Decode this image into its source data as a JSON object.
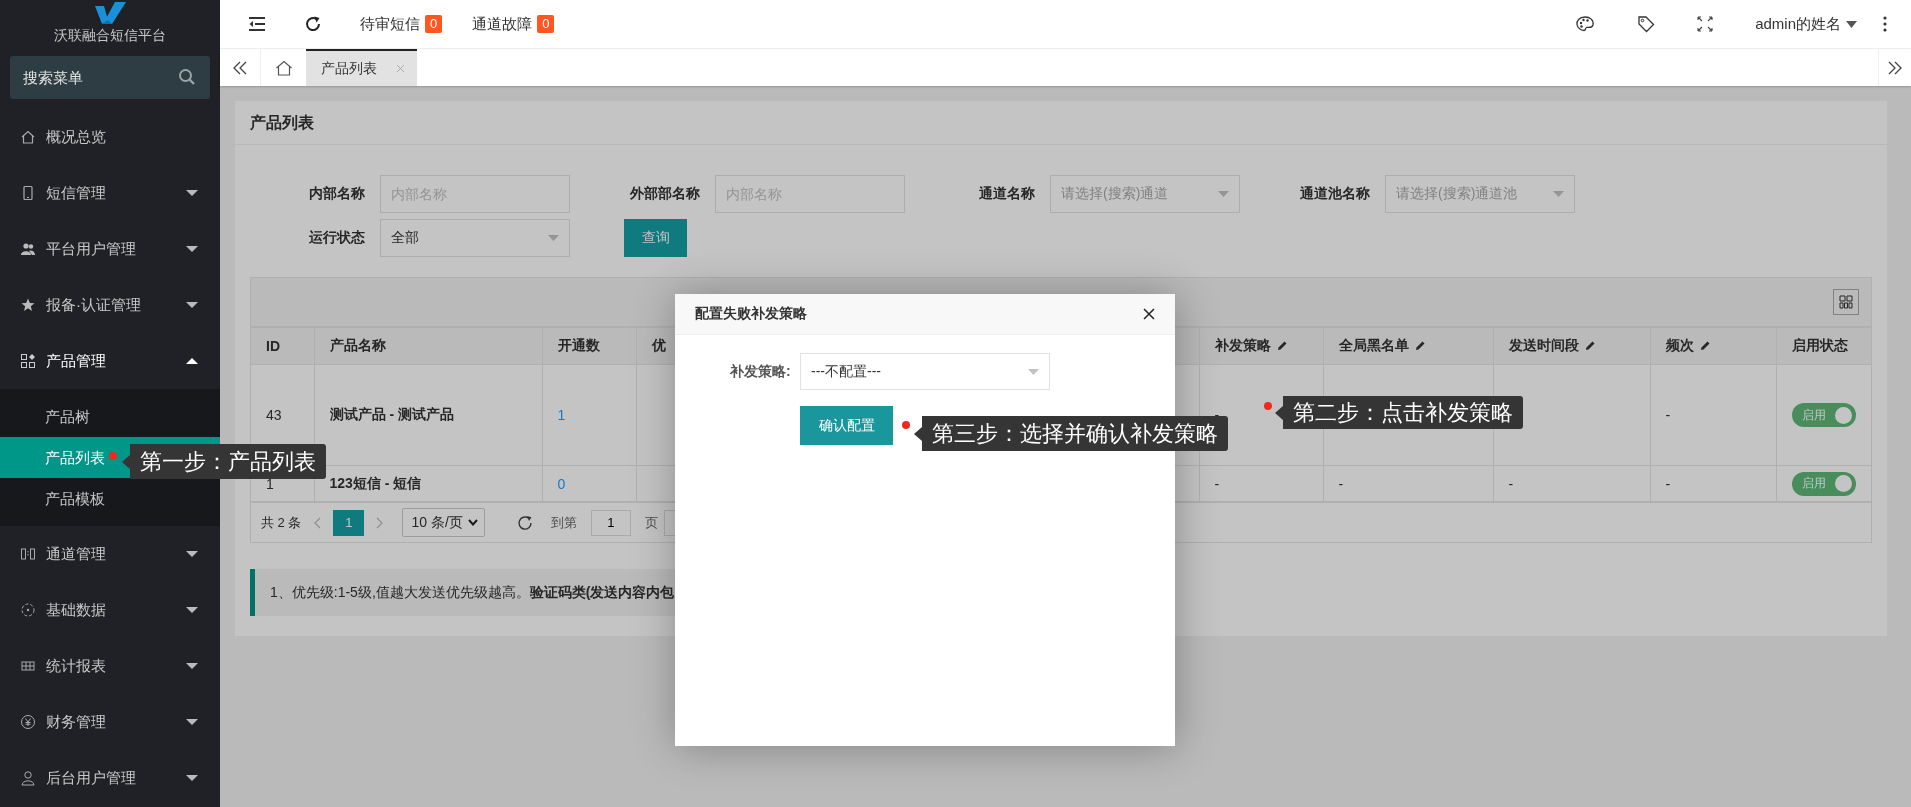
{
  "sidebar": {
    "logo_text": "沃联融合短信平台",
    "search": {
      "placeholder": "搜索菜单"
    },
    "items": [
      {
        "label": "概况总览",
        "selected": false
      },
      {
        "label": "短信管理",
        "selected": false,
        "expanded": false
      },
      {
        "label": "平台用户管理",
        "selected": false,
        "expanded": false
      },
      {
        "label": "报备·认证管理",
        "selected": false,
        "expanded": false
      },
      {
        "label": "产品管理",
        "selected": false,
        "expanded": true,
        "children": [
          {
            "label": "产品树",
            "selected": false
          },
          {
            "label": "产品列表",
            "selected": true
          },
          {
            "label": "产品模板",
            "selected": false
          }
        ]
      },
      {
        "label": "通道管理",
        "selected": false,
        "expanded": false
      },
      {
        "label": "基础数据",
        "selected": false,
        "expanded": false
      },
      {
        "label": "统计报表",
        "selected": false,
        "expanded": false
      },
      {
        "label": "财务管理",
        "selected": false,
        "expanded": false
      },
      {
        "label": "后台用户管理",
        "selected": false,
        "expanded": false
      }
    ]
  },
  "header": {
    "alerts": [
      {
        "label": "待审短信",
        "count": "0"
      },
      {
        "label": "通道故障",
        "count": "0"
      }
    ],
    "user": "admin的姓名"
  },
  "tabs": [
    {
      "label": "产品列表",
      "selected": true
    }
  ],
  "page": {
    "title": "产品列表",
    "filters": [
      {
        "kind": "input",
        "label": "内部名称",
        "placeholder": "内部名称"
      },
      {
        "kind": "input",
        "label": "外部部名称",
        "placeholder": "内部名称"
      },
      {
        "kind": "select",
        "label": "通道名称",
        "placeholder": "请选择(搜索)通道"
      },
      {
        "kind": "select",
        "label": "通道池名称",
        "placeholder": "请选择(搜索)通道池"
      },
      {
        "kind": "select",
        "label": "运行状态",
        "value": "全部"
      }
    ],
    "query_button": "查询",
    "table": {
      "columns": [
        {
          "label": "ID",
          "editable": false
        },
        {
          "label": "产品名称",
          "editable": false
        },
        {
          "label": "开通数",
          "editable": false
        },
        {
          "label": "优",
          "editable": false
        },
        {
          "label": "补发策略",
          "editable": true
        },
        {
          "label": "全局黑名单",
          "editable": true
        },
        {
          "label": "发送时间段",
          "editable": true
        },
        {
          "label": "频次",
          "editable": true
        },
        {
          "label": "启用状态",
          "editable": false
        }
      ],
      "rows": [
        {
          "cells": [
            "43",
            "测试产品 - 测试产品",
            "1",
            null,
            "-",
            null,
            null,
            "-"
          ],
          "enabled": true,
          "toggle_label": "启用"
        },
        {
          "cells": [
            "1",
            "123短信 - 短信",
            "0",
            null,
            "-",
            "-",
            "-",
            "-"
          ],
          "enabled": true,
          "toggle_label": "启用"
        }
      ]
    },
    "pager": {
      "total": "共 2 条",
      "pages": [
        {
          "label": "1",
          "selected": true
        }
      ],
      "page_size": "10 条/页",
      "goto_label": "到第",
      "goto_value": "1",
      "page_unit": "页"
    },
    "notice": "1、优先级:1-5级,值越大发送优先级越高。**验证码类(发送内容内包**"
  },
  "modal": {
    "title": "配置失败补发策略",
    "field_label": "补发策略:",
    "select_value": "---不配置---",
    "confirm_button": "确认配置"
  },
  "annotations": [
    {
      "text": "第一步：产品列表"
    },
    {
      "text": "第二步：点击补发策略"
    },
    {
      "text": "第三步：选择并确认补发策略"
    }
  ]
}
